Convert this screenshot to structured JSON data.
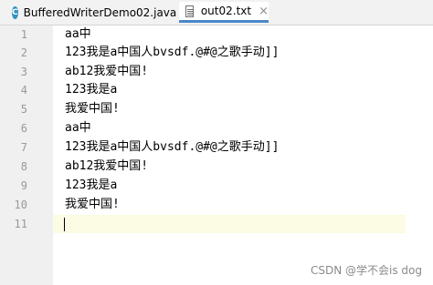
{
  "tabs": [
    {
      "label": "BufferedWriterDemo02.java",
      "icon": "java-class-icon"
    },
    {
      "label": "out02.txt",
      "icon": "text-file-icon",
      "active": true
    }
  ],
  "close_glyph": "×",
  "lines": [
    {
      "num": "1",
      "text": "aa中"
    },
    {
      "num": "2",
      "text": "123我是a中国人bvsdf.@#@之歌手动]]"
    },
    {
      "num": "3",
      "text": "ab12我爱中国!"
    },
    {
      "num": "4",
      "text": "123我是a"
    },
    {
      "num": "5",
      "text": "我爱中国!"
    },
    {
      "num": "6",
      "text": "aa中"
    },
    {
      "num": "7",
      "text": "123我是a中国人bvsdf.@#@之歌手动]]"
    },
    {
      "num": "8",
      "text": "ab12我爱中国!"
    },
    {
      "num": "9",
      "text": "123我是a"
    },
    {
      "num": "10",
      "text": "我爱中国!"
    },
    {
      "num": "11",
      "text": ""
    }
  ],
  "watermark": "CSDN @学不会is dog",
  "colors": {
    "gutter_bg": "#f0f0f0",
    "line_number": "#999999",
    "current_line": "#fcfbe3",
    "active_tab_underline": "#4a88c7",
    "java_icon": "#3592c4"
  }
}
